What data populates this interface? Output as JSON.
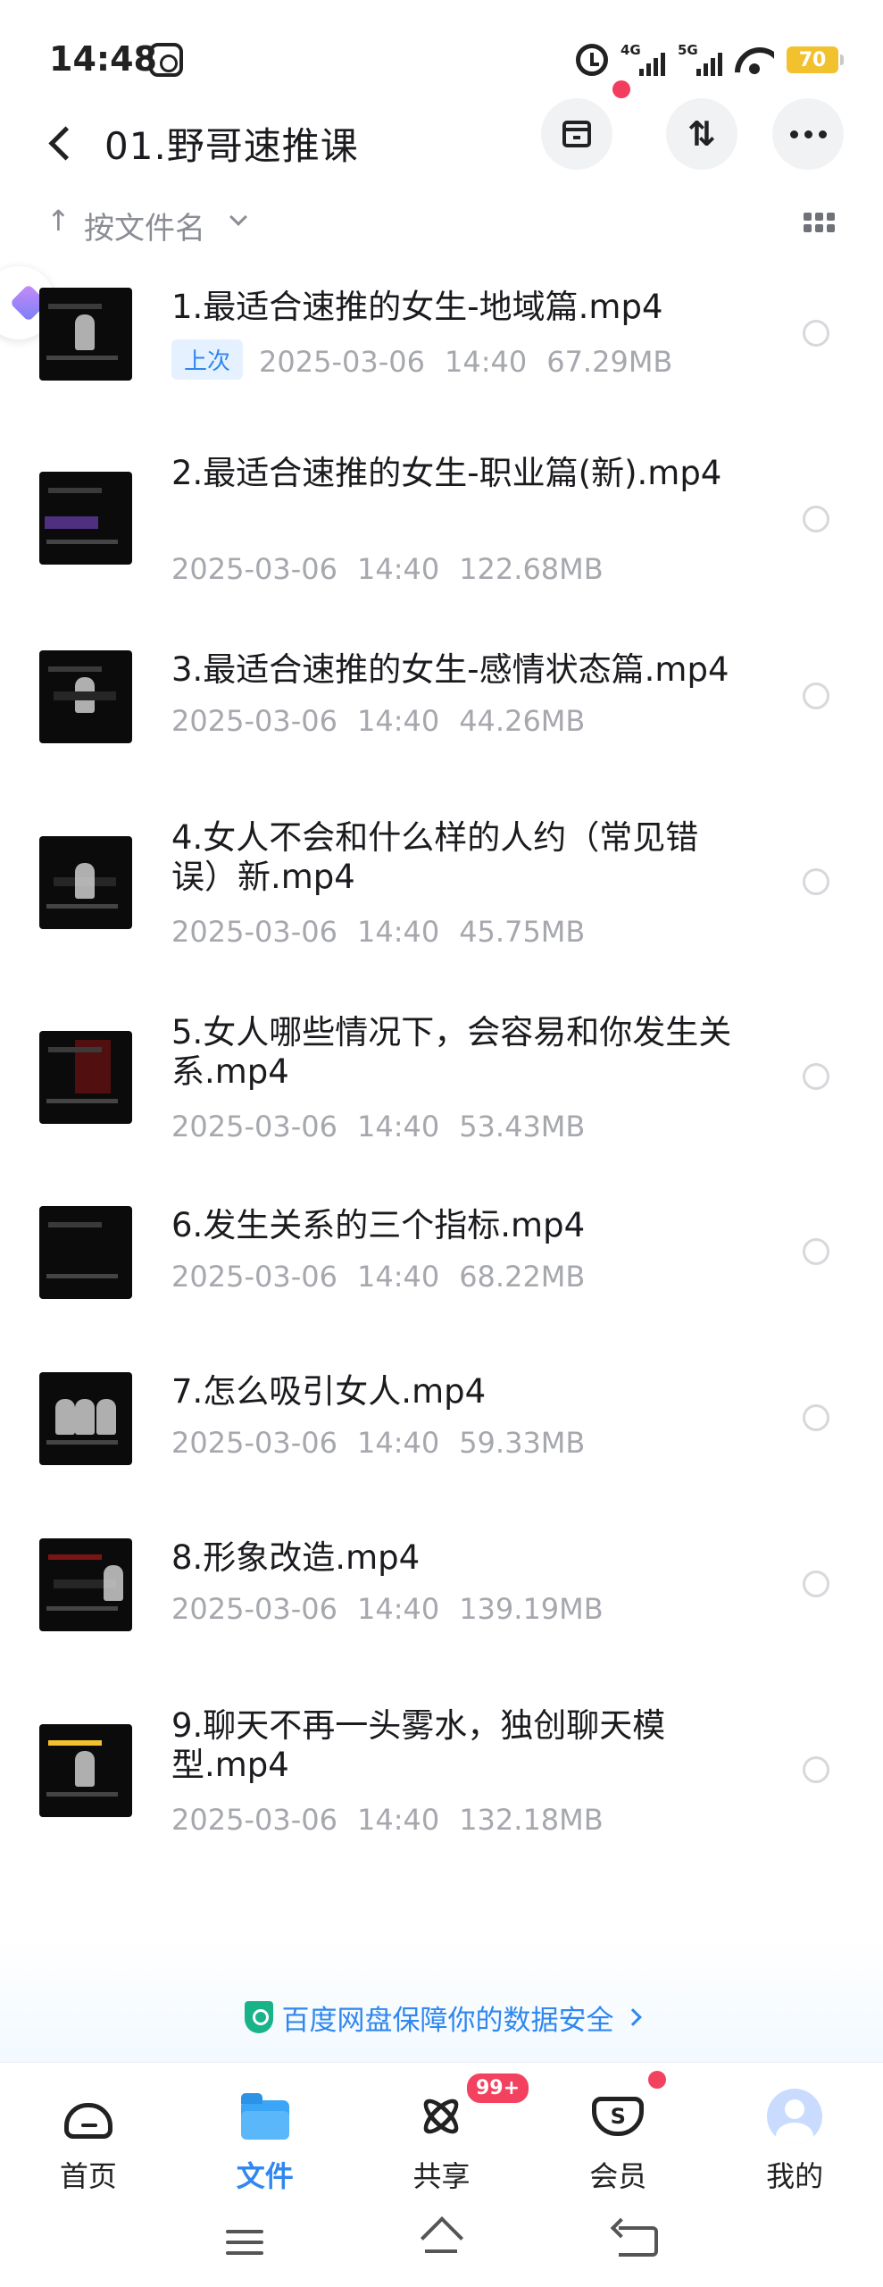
{
  "status_bar": {
    "time": "14:48",
    "signal_1": "4G",
    "signal_2": "5G",
    "battery": "70"
  },
  "header": {
    "title": "01.野哥速推课"
  },
  "sort": {
    "arrow": "↑",
    "label": "按文件名"
  },
  "files": [
    {
      "name": "1.最适合速推的女生-地域篇.mp4",
      "badge": "上次",
      "date": "2025-03-06",
      "time": "14:40",
      "size": "67.29MB"
    },
    {
      "name": "2.最适合速推的女生-职业篇(新).mp4",
      "date": "2025-03-06",
      "time": "14:40",
      "size": "122.68MB"
    },
    {
      "name": "3.最适合速推的女生-感情状态篇.mp4",
      "date": "2025-03-06",
      "time": "14:40",
      "size": "44.26MB"
    },
    {
      "name": "4.女人不会和什么样的人约（常见错误）新.mp4",
      "date": "2025-03-06",
      "time": "14:40",
      "size": "45.75MB"
    },
    {
      "name": "5.女人哪些情况下，会容易和你发生关系.mp4",
      "date": "2025-03-06",
      "time": "14:40",
      "size": "53.43MB"
    },
    {
      "name": "6.发生关系的三个指标.mp4",
      "date": "2025-03-06",
      "time": "14:40",
      "size": "68.22MB"
    },
    {
      "name": "7.怎么吸引女人.mp4",
      "date": "2025-03-06",
      "time": "14:40",
      "size": "59.33MB"
    },
    {
      "name": "8.形象改造.mp4",
      "date": "2025-03-06",
      "time": "14:40",
      "size": "139.19MB"
    },
    {
      "name": "9.聊天不再一头雾水，独创聊天模型.mp4",
      "date": "2025-03-06",
      "time": "14:40",
      "size": "132.18MB"
    }
  ],
  "security": {
    "text": "百度网盘保障你的数据安全"
  },
  "bottom_nav": {
    "home": "首页",
    "files": "文件",
    "share": "共享",
    "share_badge": "99+",
    "vip": "会员",
    "vip_icon": "S",
    "me": "我的"
  },
  "colors": {
    "accent": "#2f87ef",
    "badge_red": "#f2425f",
    "meta_gray": "#a6a8ae"
  }
}
